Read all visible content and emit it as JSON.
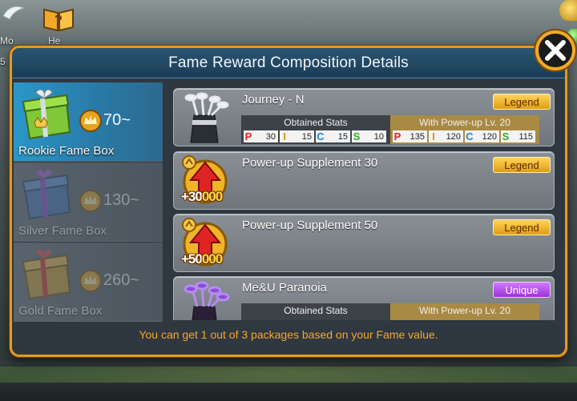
{
  "hud": {
    "left_label_1": "Mo",
    "left_label_2": "He",
    "left_number": "5"
  },
  "modal": {
    "title": "Fame Reward Composition Details",
    "footer_note": "You can get 1 out of 3 packages based on your Fame value."
  },
  "tabs": [
    {
      "label": "Rookie Fame Box",
      "cost": "70~",
      "active": true,
      "color": "#7ec83a"
    },
    {
      "label": "Silver Fame Box",
      "cost": "130~",
      "active": false,
      "color": "#3a6fb8"
    },
    {
      "label": "Gold Fame Box",
      "cost": "260~",
      "active": false,
      "color": "#c79a2a"
    }
  ],
  "rewards": [
    {
      "name": "Journey - N",
      "grade": "Legend",
      "icon": "golf-club-set-icon",
      "obtained_label": "Obtained Stats",
      "powerup_label": "With Power-up Lv. 20",
      "obtained": [
        {
          "k": "P",
          "v": "30"
        },
        {
          "k": "I",
          "v": "15"
        },
        {
          "k": "C",
          "v": "15"
        },
        {
          "k": "S",
          "v": "10"
        }
      ],
      "powerup": [
        {
          "k": "P",
          "v": "135"
        },
        {
          "k": "I",
          "v": "120"
        },
        {
          "k": "C",
          "v": "120"
        },
        {
          "k": "S",
          "v": "115"
        }
      ]
    },
    {
      "name": "Power-up Supplement 30",
      "grade": "Legend",
      "icon": "power-up-arrow-icon",
      "amount_prefix": "+30",
      "amount_highlight": "000"
    },
    {
      "name": "Power-up Supplement 50",
      "grade": "Legend",
      "icon": "power-up-arrow-icon",
      "amount_prefix": "+50",
      "amount_highlight": "000"
    },
    {
      "name": "Me&U Paranoia",
      "grade": "Unique",
      "icon": "golf-club-set-purple-icon",
      "obtained_label": "Obtained Stats",
      "powerup_label": "With Power-up Lv. 20"
    }
  ]
}
